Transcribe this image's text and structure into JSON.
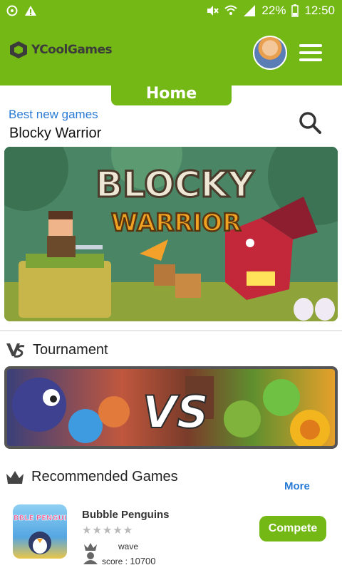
{
  "status_bar": {
    "battery": "22%",
    "time": "12:50"
  },
  "header": {
    "logo_text": "YCoolGames"
  },
  "home_tab": {
    "label": "Home"
  },
  "best_new_games": {
    "section_label": "Best new games",
    "game_title": "Blocky Warrior",
    "banner_text_line1": "BLOCKY",
    "banner_text_line2": "WARRIOR"
  },
  "tournament": {
    "title": "Tournament",
    "banner_text": "VS"
  },
  "recommended": {
    "title": "Recommended Games",
    "more_label": "More",
    "items": [
      {
        "name": "Bubble Penguins",
        "thumb_text": "BUBBLE PENGUINS",
        "rating": 0,
        "stars": "★★★★★",
        "player": "wave",
        "score_prefix": "score : ",
        "score": "10700",
        "action_label": "Compete"
      }
    ]
  },
  "colors": {
    "brand_green": "#74b815",
    "link_blue": "#2a7bd6"
  }
}
